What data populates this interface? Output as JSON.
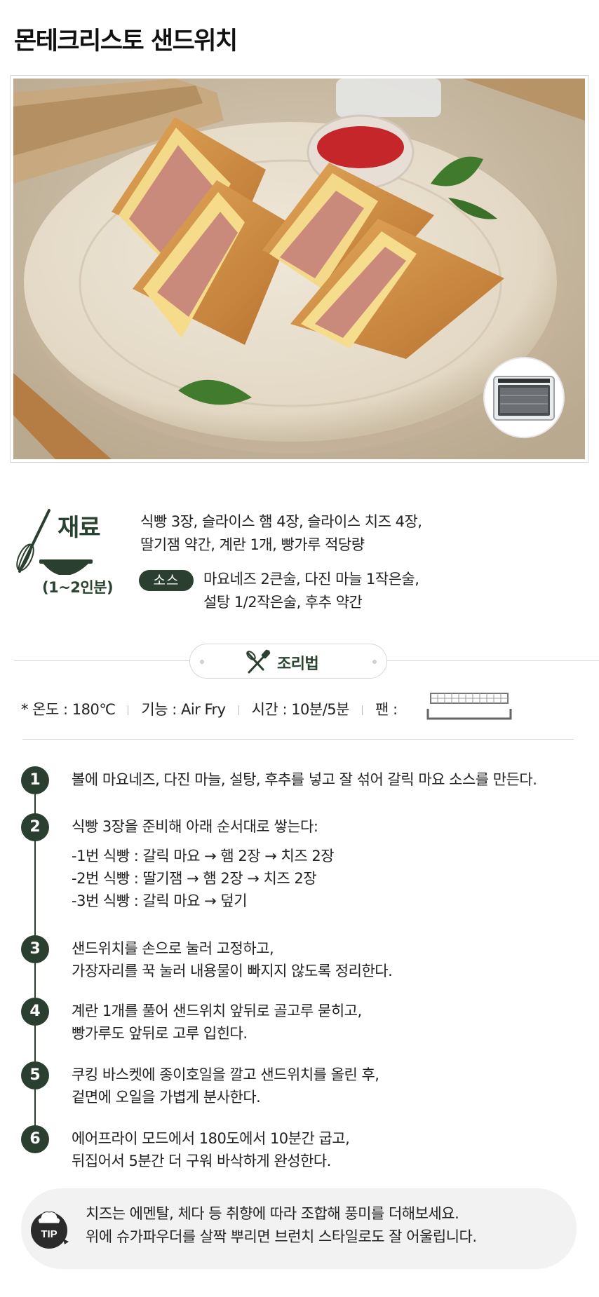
{
  "title": "몬테크리스토 샌드위치",
  "ingredients": {
    "heading": "재료",
    "servings": "(1~2인분)",
    "main_line1": "식빵 3장, 슬라이스 햄 4장, 슬라이스 치즈 4장,",
    "main_line2": "딸기잼 약간, 계란 1개, 빵가루 적당량",
    "sauce_label": "소스",
    "sauce_line1": "마요네즈 2큰술, 다진 마늘 1작은술,",
    "sauce_line2": "설탕 1/2작은술, 후추 약간"
  },
  "method": {
    "heading": "조리법"
  },
  "info": {
    "temp": "* 온도 : 180℃",
    "function": "기능 : Air Fry",
    "time": "시간 : 10분/5분",
    "pan": "팬 :"
  },
  "steps": [
    {
      "num": "1",
      "lines": [
        "볼에 마요네즈, 다진 마늘, 설탕, 후추를 넣고 잘 섞어 갈릭 마요 소스를 만든다."
      ]
    },
    {
      "num": "2",
      "lines": [
        "식빵 3장을 준비해 아래 순서대로 쌓는다:"
      ],
      "sub": [
        "-1번 식빵 : 갈릭 마요 → 햄 2장 → 치즈 2장",
        "-2번 식빵 : 딸기잼 → 햄 2장 → 치즈 2장",
        "-3번 식빵 : 갈릭 마요 → 덮기"
      ]
    },
    {
      "num": "3",
      "lines": [
        "샌드위치를 손으로 눌러 고정하고,",
        "가장자리를 꾹 눌러 내용물이 빠지지 않도록 정리한다."
      ]
    },
    {
      "num": "4",
      "lines": [
        "계란 1개를 풀어 샌드위치 앞뒤로 골고루 묻히고,",
        "빵가루도 앞뒤로 고루 입힌다."
      ]
    },
    {
      "num": "5",
      "lines": [
        "쿠킹 바스켓에 종이호일을 깔고 샌드위치를 올린 후,",
        "겉면에 오일을 가볍게 분사한다."
      ]
    },
    {
      "num": "6",
      "lines": [
        "에어프라이 모드에서 180도에서 10분간 굽고,",
        "뒤집어서 5분간 더 구워 바삭하게 완성한다."
      ]
    }
  ],
  "tip": {
    "icon_label": "TIP",
    "line1": "치즈는 에멘탈, 체다 등 취향에 따라 조합해 풍미를 더해보세요.",
    "line2": "위에 슈가파우더를 살짝 뿌리면 브런치 스타일로도 잘 어울립니다."
  },
  "colors": {
    "accent_green": "#2b3f30",
    "tip_bg": "#f2f2f2"
  },
  "icons": [
    "whisk-bowl-icon",
    "whisk-spatula-icon",
    "grill-pan-icon",
    "chef-tip-icon",
    "air-fryer-oven-icon"
  ]
}
